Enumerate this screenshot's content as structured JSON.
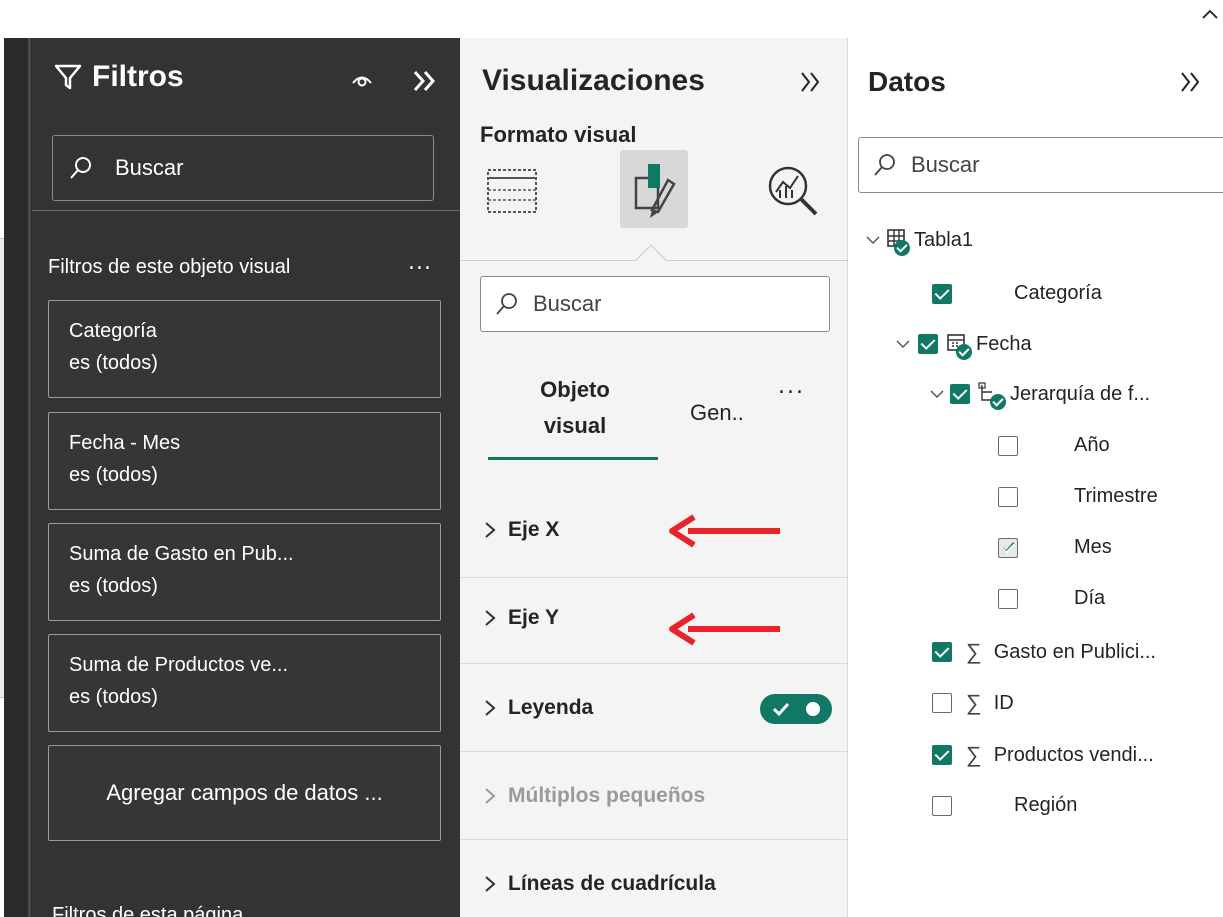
{
  "colors": {
    "accent": "#117865",
    "filters_bg": "#333333",
    "viz_bg": "#f4f4f4",
    "arrow": "#e8242a"
  },
  "icons": {
    "top_right": "chevron-up-icon",
    "filters": "funnel-icon",
    "visibility": "eye-icon",
    "collapse": "double-chevron-right-icon",
    "search": "search-icon",
    "viz_build": "build-visual-icon",
    "viz_format": "format-paintbrush-icon",
    "viz_analytics": "analytics-magnifier-icon",
    "table": "table-icon",
    "calendar": "calendar-table-icon",
    "hierarchy": "hierarchy-icon",
    "measure": "sigma-icon"
  },
  "filters_pane": {
    "title": "Filtros",
    "search_placeholder": "Buscar",
    "section_label": "Filtros de este objeto visual",
    "more": "...",
    "cards": [
      {
        "field": "Categoría",
        "state": "es (todos)"
      },
      {
        "field": "Fecha - Mes",
        "state": "es (todos)"
      },
      {
        "field": "Suma de Gasto en Pub...",
        "state": "es (todos)"
      },
      {
        "field": "Suma de Productos ve...",
        "state": "es (todos)"
      }
    ],
    "add_fields": "Agregar campos de datos ...",
    "page_filters_label": "Filtros de esta página"
  },
  "viz_pane": {
    "title": "Visualizaciones",
    "subtitle": "Formato visual",
    "search_placeholder": "Buscar",
    "tab_visual_line1": "Objeto",
    "tab_visual_line2": "visual",
    "tab_general": "Gen..",
    "more": "...",
    "sections": {
      "x_axis": "Eje X",
      "y_axis": "Eje Y",
      "legend": "Leyenda",
      "small_multiples": "Múltiplos pequeños",
      "gridlines": "Líneas de cuadrícula"
    },
    "legend_toggle_on": true
  },
  "data_pane": {
    "title": "Datos",
    "search_placeholder": "Buscar",
    "table": "Tabla1",
    "fields": {
      "categoria": "Categoría",
      "fecha": "Fecha",
      "jerarquia": "Jerarquía de f...",
      "anio": "Año",
      "trimestre": "Trimestre",
      "mes": "Mes",
      "dia": "Día",
      "gasto": "Gasto en Publici...",
      "id": "ID",
      "productos": "Productos vendi...",
      "region": "Región"
    },
    "checked": {
      "categoria": true,
      "fecha": true,
      "jerarquia": true,
      "anio": false,
      "trimestre": false,
      "mes": true,
      "dia": false,
      "gasto": true,
      "id": false,
      "productos": true,
      "region": false
    }
  }
}
